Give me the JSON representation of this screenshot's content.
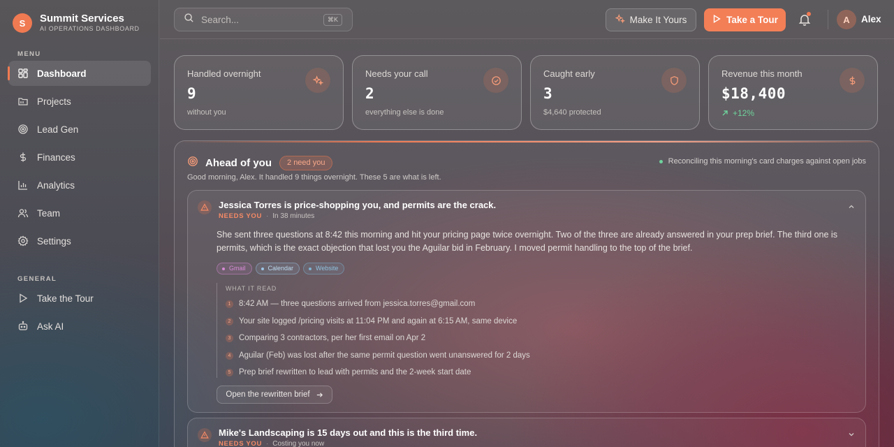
{
  "brand": {
    "logo_letter": "S",
    "name": "Summit Services",
    "subtitle": "AI OPERATIONS DASHBOARD"
  },
  "sidebar": {
    "menu_label": "MENU",
    "menu_items": [
      {
        "label": "Dashboard",
        "icon": "dashboard-icon",
        "active": true
      },
      {
        "label": "Projects",
        "icon": "folder-icon"
      },
      {
        "label": "Lead Gen",
        "icon": "target-icon"
      },
      {
        "label": "Finances",
        "icon": "dollar-icon"
      },
      {
        "label": "Analytics",
        "icon": "bar-chart-icon"
      },
      {
        "label": "Team",
        "icon": "users-icon"
      },
      {
        "label": "Settings",
        "icon": "gear-icon"
      }
    ],
    "general_label": "GENERAL",
    "general_items": [
      {
        "label": "Take the Tour",
        "icon": "play-icon"
      },
      {
        "label": "Ask AI",
        "icon": "bot-icon"
      }
    ]
  },
  "topbar": {
    "search_placeholder": "Search...",
    "search_shortcut": "⌘K",
    "make_it_yours": "Make It Yours",
    "take_tour": "Take a Tour",
    "user_initial": "A",
    "user_name": "Alex"
  },
  "stats": [
    {
      "label": "Handled overnight",
      "value": "9",
      "sub": "without you",
      "icon": "sparkles-icon"
    },
    {
      "label": "Needs your call",
      "value": "2",
      "sub": "everything else is done",
      "icon": "check-circle-icon"
    },
    {
      "label": "Caught early",
      "value": "3",
      "sub": "$4,640 protected",
      "icon": "shield-icon"
    },
    {
      "label": "Revenue this month",
      "value": "$18,400",
      "trend": "+12%",
      "icon": "dollar-icon"
    }
  ],
  "ahead": {
    "title": "Ahead of you",
    "badge": "2 need you",
    "status": "Reconciling this morning's card charges against open jobs",
    "intro": "Good morning, Alex. It handled 9 things overnight. These 5 are what is left.",
    "items": [
      {
        "title": "Jessica Torres is price-shopping you, and permits are the crack.",
        "tag": "NEEDS YOU",
        "when": "In 38 minutes",
        "body": "She sent three questions at 8:42 this morning and hit your pricing page twice overnight. Two of the three are already answered in your prep brief. The third one is permits, which is the exact objection that lost you the Aguilar bid in February. I moved permit handling to the top of the brief.",
        "sources": [
          "Gmail",
          "Calendar",
          "Website"
        ],
        "read_label": "WHAT IT READ",
        "steps": [
          "8:42 AM — three questions arrived from jessica.torres@gmail.com",
          "Your site logged /pricing visits at 11:04 PM and again at 6:15 AM, same device",
          "Comparing 3 contractors, per her first email on Apr 2",
          "Aguilar (Feb) was lost after the same permit question went unanswered for 2 days",
          "Prep brief rewritten to lead with permits and the 2-week start date"
        ],
        "action": "Open the rewritten brief"
      },
      {
        "title": "Mike's Landscaping is 15 days out and this is the third time.",
        "tag": "NEEDS YOU",
        "when": "Costing you now"
      }
    ]
  },
  "colors": {
    "accent": "#f07a52",
    "positive": "#6fd39c",
    "gmail": "#d78ad6",
    "calendar": "#9cc6e6",
    "website": "#7fb4d4"
  }
}
